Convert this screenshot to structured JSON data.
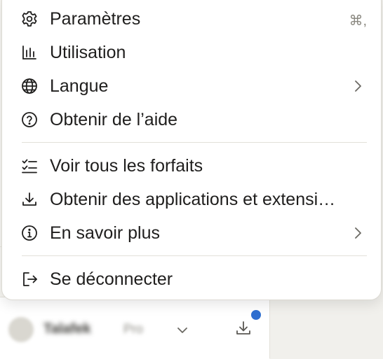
{
  "menu": {
    "items": [
      {
        "label": "Paramètres",
        "icon": "gear-icon",
        "shortcut": "⌘,"
      },
      {
        "label": "Utilisation",
        "icon": "bar-chart-icon"
      },
      {
        "label": "Langue",
        "icon": "globe-icon",
        "submenu": true
      },
      {
        "label": "Obtenir de l’aide",
        "icon": "help-circle-icon"
      },
      {
        "label": "Voir tous les forfaits",
        "icon": "checklist-icon"
      },
      {
        "label": "Obtenir des applications et extensi…",
        "icon": "download-icon"
      },
      {
        "label": "En savoir plus",
        "icon": "info-circle-icon",
        "submenu": true
      },
      {
        "label": "Se déconnecter",
        "icon": "logout-icon"
      }
    ]
  },
  "account": {
    "name": "Talafek",
    "plan": "Pro",
    "notification_color": "#2f6fd0"
  }
}
